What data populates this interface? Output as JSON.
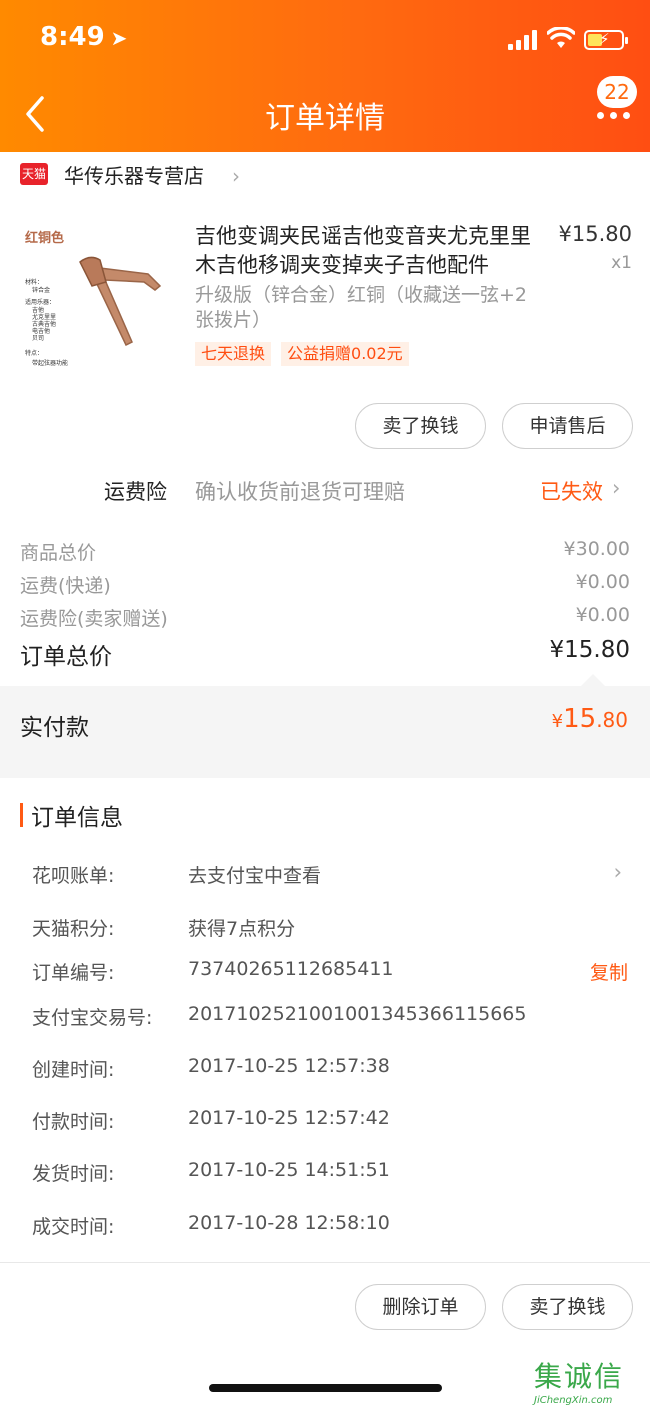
{
  "status": {
    "time": "8:49"
  },
  "header": {
    "title": "订单详情",
    "badge": "22"
  },
  "store": {
    "logo_text": "天猫",
    "name": "华传乐器专营店"
  },
  "product": {
    "image_title": "红铜色",
    "image_lines": [
      "材料：",
      "锌合金",
      "适用乐器：",
      "吉他",
      "尤克里里",
      "古典吉他",
      "电吉他",
      "贝司",
      "特点：",
      "带起弦器功能"
    ],
    "title": "吉他变调夹民谣吉他变音夹尤克里里木吉他移调夹变掉夹子吉他配件",
    "price": "¥15.80",
    "qty": "x1",
    "sku": "升级版（锌合金）红铜（收藏送一弦+2张拨片）",
    "tags": [
      "七天退换",
      "公益捐赠0.02元"
    ]
  },
  "actions_top": {
    "sell": "卖了换钱",
    "after_sale": "申请售后"
  },
  "insurance": {
    "label": "运费险",
    "desc": "确认收货前退货可理赔",
    "status": "已失效"
  },
  "summary": {
    "rows": [
      {
        "k": "商品总价",
        "v": "¥30.00"
      },
      {
        "k": "运费(快递)",
        "v": "¥0.00"
      },
      {
        "k": "运费险(卖家赠送)",
        "v": "¥0.00"
      }
    ],
    "total_label": "订单总价",
    "total_value": "¥15.80",
    "paid_label": "实付款",
    "paid_currency": "¥",
    "paid_int": "15",
    "paid_dec": ".80"
  },
  "order_info": {
    "title": "订单信息",
    "rows": [
      {
        "k": "花呗账单:",
        "v": "去支付宝中查看"
      },
      {
        "k": "天猫积分:",
        "v": "获得7点积分"
      },
      {
        "k": "订单编号:",
        "v": "73740265112685411",
        "action": "复制"
      },
      {
        "k": "支付宝交易号:",
        "v": "2017102521001001345366115665"
      },
      {
        "k": "创建时间:",
        "v": "2017-10-25 12:57:38"
      },
      {
        "k": "付款时间:",
        "v": "2017-10-25 12:57:42"
      },
      {
        "k": "发货时间:",
        "v": "2017-10-25 14:51:51"
      },
      {
        "k": "成交时间:",
        "v": "2017-10-28 12:58:10"
      }
    ]
  },
  "actions_bottom": {
    "delete": "删除订单",
    "sell": "卖了换钱"
  },
  "watermark": {
    "chars": "集诚信",
    "url": "JiChengXin.com"
  },
  "colors": {
    "accent": "#ff5a14",
    "header_start": "#ff8a00",
    "header_end": "#ff4e12",
    "tmall": "#e8232b"
  }
}
